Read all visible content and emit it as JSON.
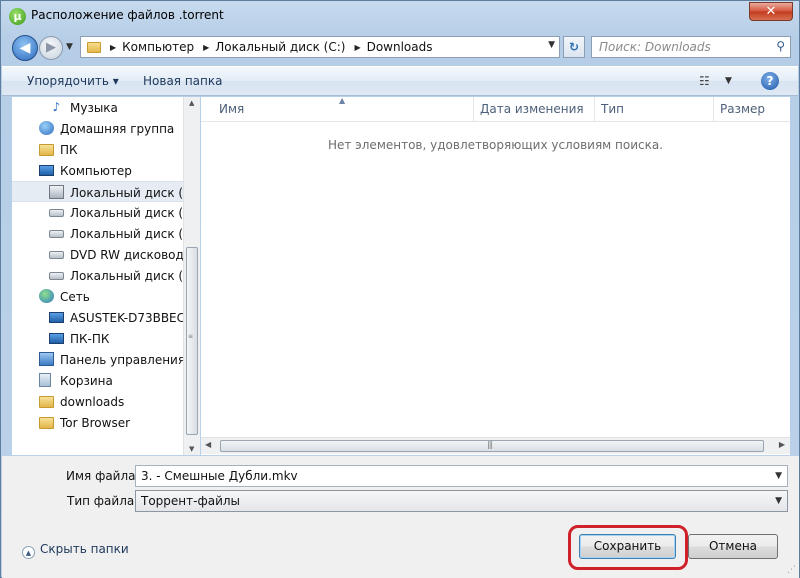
{
  "window": {
    "title": "Расположение файлов .torrent",
    "app_icon_glyph": "µ",
    "close_glyph": "✕"
  },
  "address": {
    "back_glyph": "◀",
    "forward_glyph": "▶",
    "breadcrumbs": [
      "Компьютер",
      "Локальный диск (C:)",
      "Downloads"
    ],
    "refresh_glyph": "↻",
    "search_placeholder": "Поиск: Downloads"
  },
  "toolbar": {
    "organize_label": "Упорядочить ▾",
    "new_folder_label": "Новая папка",
    "view_glyph": "☷",
    "help_glyph": "?"
  },
  "sidebar": {
    "items": [
      {
        "label": "Музыка",
        "icon": "music-icon",
        "indent": 2
      },
      {
        "label": "Домашняя группа",
        "icon": "homegroup-icon",
        "indent": 1
      },
      {
        "label": "ПК",
        "icon": "folder-icon",
        "indent": 1
      },
      {
        "label": "Компьютер",
        "icon": "computer-icon",
        "indent": 1
      },
      {
        "label": "Локальный диск (C:)",
        "icon": "windows-drive-icon",
        "indent": 2,
        "selected": true
      },
      {
        "label": "Локальный диск (D:)",
        "icon": "drive-icon",
        "indent": 2
      },
      {
        "label": "Локальный диск (E:)",
        "icon": "drive-icon",
        "indent": 2
      },
      {
        "label": "DVD RW дисковод (F",
        "icon": "drive-icon",
        "indent": 2
      },
      {
        "label": "Локальный диск (Y:)",
        "icon": "drive-icon",
        "indent": 2
      },
      {
        "label": "Сеть",
        "icon": "network-icon",
        "indent": 1
      },
      {
        "label": "ASUSTEK-D73BBEC",
        "icon": "computer-icon",
        "indent": 2
      },
      {
        "label": "ПК-ПК",
        "icon": "computer-icon",
        "indent": 2
      },
      {
        "label": "Панель управления",
        "icon": "control-panel-icon",
        "indent": 1
      },
      {
        "label": "Корзина",
        "icon": "recycle-bin-icon",
        "indent": 1
      },
      {
        "label": "downloads",
        "icon": "folder-icon",
        "indent": 1
      },
      {
        "label": "Tor Browser",
        "icon": "folder-icon",
        "indent": 1
      }
    ]
  },
  "content": {
    "columns": [
      "Имя",
      "Дата изменения",
      "Тип",
      "Размер"
    ],
    "empty_message": "Нет элементов, удовлетворяющих условиям поиска."
  },
  "form": {
    "filename_label": "Имя файла:",
    "filename_value": "3. - Смешные Дубли.mkv",
    "filetype_label": "Тип файла:",
    "filetype_value": "Торрент-файлы",
    "hide_folders_label": "Скрыть папки",
    "save_label": "Сохранить",
    "cancel_label": "Отмена"
  }
}
